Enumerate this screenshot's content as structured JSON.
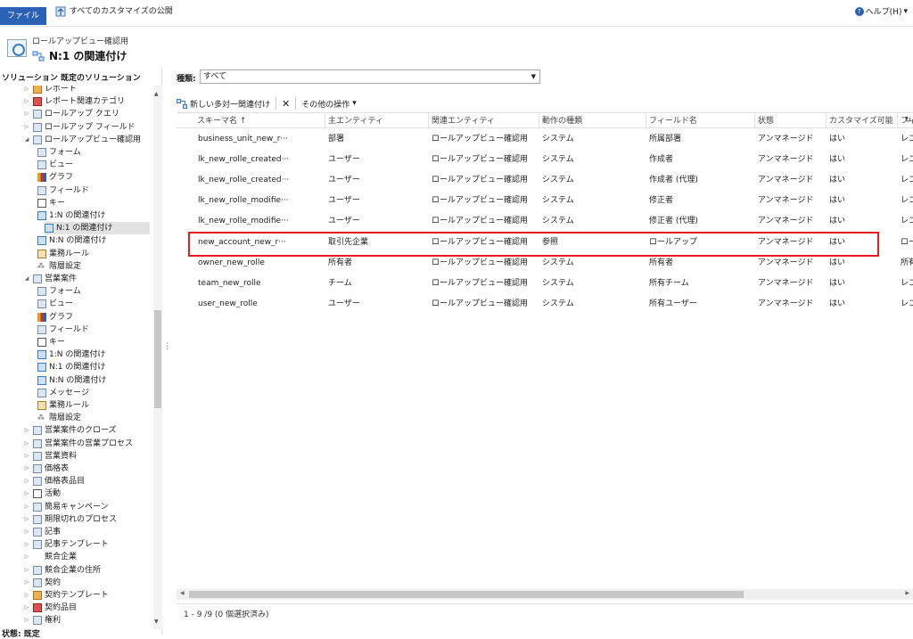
{
  "topbar": {
    "file_label": "ファイル",
    "publish_label": "すべてのカスタマイズの公開",
    "help_label": "ヘルプ(H)",
    "help_caret": "▾"
  },
  "header": {
    "entity_name": "ロールアップビュー確認用",
    "view_title": "N:1 の関連付け"
  },
  "sidebar": {
    "heading": "ソリューション 既定のソリューション",
    "bottom_label": "状態: 既定",
    "items": [
      {
        "label": "レポート",
        "icon": "report-icon",
        "arrow": "▷",
        "indent": 0
      },
      {
        "label": "レポート関連カテゴリ",
        "icon": "report-category-icon",
        "arrow": "▷",
        "indent": 0
      },
      {
        "label": "ロールアップ クエリ",
        "icon": "rollup-query-icon",
        "arrow": "▷",
        "indent": 0
      },
      {
        "label": "ロールアップ フィールド",
        "icon": "rollup-field-icon",
        "arrow": "▷",
        "indent": 0
      },
      {
        "label": "ロールアップビュー確認用",
        "icon": "entity-icon",
        "arrow": "◢",
        "indent": 0
      },
      {
        "label": "フォーム",
        "icon": "form-icon",
        "arrow": "",
        "indent": 1
      },
      {
        "label": "ビュー",
        "icon": "view-icon",
        "arrow": "",
        "indent": 1
      },
      {
        "label": "グラフ",
        "icon": "chart-icon",
        "arrow": "",
        "indent": 1
      },
      {
        "label": "フィールド",
        "icon": "field-icon",
        "arrow": "",
        "indent": 1
      },
      {
        "label": "キー",
        "icon": "key-icon",
        "arrow": "",
        "indent": 1
      },
      {
        "label": "1:N の関連付け",
        "icon": "relationship-icon",
        "arrow": "",
        "indent": 1
      },
      {
        "label": "N:1 の関連付け",
        "icon": "relationship-icon",
        "arrow": "",
        "indent": 1,
        "selected": true
      },
      {
        "label": "N:N の関連付け",
        "icon": "relationship-icon",
        "arrow": "",
        "indent": 1
      },
      {
        "label": "業務ルール",
        "icon": "business-rule-icon",
        "arrow": "",
        "indent": 1
      },
      {
        "label": "階層設定",
        "icon": "hierarchy-icon",
        "arrow": "",
        "indent": 1
      },
      {
        "label": "営業案件",
        "icon": "entity-icon",
        "arrow": "◢",
        "indent": 0
      },
      {
        "label": "フォーム",
        "icon": "form-icon",
        "arrow": "",
        "indent": 1
      },
      {
        "label": "ビュー",
        "icon": "view-icon",
        "arrow": "",
        "indent": 1
      },
      {
        "label": "グラフ",
        "icon": "chart-icon",
        "arrow": "",
        "indent": 1
      },
      {
        "label": "フィールド",
        "icon": "field-icon",
        "arrow": "",
        "indent": 1
      },
      {
        "label": "キー",
        "icon": "key-icon",
        "arrow": "",
        "indent": 1
      },
      {
        "label": "1:N の関連付け",
        "icon": "relationship-icon",
        "arrow": "",
        "indent": 1
      },
      {
        "label": "N:1 の関連付け",
        "icon": "relationship-icon",
        "arrow": "",
        "indent": 1
      },
      {
        "label": "N:N の関連付け",
        "icon": "relationship-icon",
        "arrow": "",
        "indent": 1
      },
      {
        "label": "メッセージ",
        "icon": "message-icon",
        "arrow": "",
        "indent": 1
      },
      {
        "label": "業務ルール",
        "icon": "business-rule-icon",
        "arrow": "",
        "indent": 1
      },
      {
        "label": "階層設定",
        "icon": "hierarchy-icon",
        "arrow": "",
        "indent": 1
      },
      {
        "label": "営業案件のクローズ",
        "icon": "opportunity-close-icon",
        "arrow": "▷",
        "indent": 0
      },
      {
        "label": "営業案件の営業プロセス",
        "icon": "sales-process-icon",
        "arrow": "▷",
        "indent": 0
      },
      {
        "label": "営業資料",
        "icon": "sales-literature-icon",
        "arrow": "▷",
        "indent": 0
      },
      {
        "label": "価格表",
        "icon": "price-list-icon",
        "arrow": "▷",
        "indent": 0
      },
      {
        "label": "価格表品目",
        "icon": "price-list-item-icon",
        "arrow": "▷",
        "indent": 0
      },
      {
        "label": "活動",
        "icon": "activity-icon",
        "arrow": "▷",
        "indent": 0
      },
      {
        "label": "簡易キャンペーン",
        "icon": "quick-campaign-icon",
        "arrow": "▷",
        "indent": 0
      },
      {
        "label": "期限切れのプロセス",
        "icon": "expired-process-icon",
        "arrow": "▷",
        "indent": 0
      },
      {
        "label": "記事",
        "icon": "article-icon",
        "arrow": "▷",
        "indent": 0
      },
      {
        "label": "記事テンプレート",
        "icon": "article-template-icon",
        "arrow": "▷",
        "indent": 0
      },
      {
        "label": "競合企業",
        "icon": "competitor-icon",
        "arrow": "▷",
        "indent": 0
      },
      {
        "label": "競合企業の住所",
        "icon": "competitor-address-icon",
        "arrow": "▷",
        "indent": 0
      },
      {
        "label": "契約",
        "icon": "contract-icon",
        "arrow": "▷",
        "indent": 0
      },
      {
        "label": "契約テンプレート",
        "icon": "contract-template-icon",
        "arrow": "▷",
        "indent": 0
      },
      {
        "label": "契約品目",
        "icon": "contract-line-icon",
        "arrow": "▷",
        "indent": 0
      },
      {
        "label": "権利",
        "icon": "entitlement-icon",
        "arrow": "▷",
        "indent": 0
      }
    ]
  },
  "filter": {
    "label": "種類:",
    "value": "すべて"
  },
  "toolbar": {
    "new_label": "新しい多対一関連付け",
    "delete_glyph": "✕",
    "more_label": "その他の操作",
    "more_caret": "▾"
  },
  "grid": {
    "columns": [
      "スキーマ名 ↑",
      "主エンティティ",
      "関連エンティティ",
      "動作の種類",
      "フィールド名",
      "状態",
      "カスタマイズ可能",
      "フィ-"
    ],
    "rows": [
      [
        "business_unit_new_r···",
        "部署",
        "ロールアップビュー確認用",
        "システム",
        "所属部署",
        "アンマネージド",
        "はい",
        "レコードを"
      ],
      [
        "lk_new_rolle_created···",
        "ユーザー",
        "ロールアップビュー確認用",
        "システム",
        "作成者",
        "アンマネージド",
        "はい",
        "レコードを"
      ],
      [
        "lk_new_rolle_created···",
        "ユーザー",
        "ロールアップビュー確認用",
        "システム",
        "作成者 (代理)",
        "アンマネージド",
        "はい",
        "レコードを"
      ],
      [
        "lk_new_rolle_modifie···",
        "ユーザー",
        "ロールアップビュー確認用",
        "システム",
        "修正者",
        "アンマネージド",
        "はい",
        "レコードを"
      ],
      [
        "lk_new_rolle_modifie···",
        "ユーザー",
        "ロールアップビュー確認用",
        "システム",
        "修正者 (代理)",
        "アンマネージド",
        "はい",
        "レコードを"
      ],
      [
        "new_account_new_r···",
        "取引先企業",
        "ロールアップビュー確認用",
        "参照",
        "ロールアップ",
        "アンマネージド",
        "はい",
        "ロールアッ"
      ],
      [
        "owner_new_rolle",
        "所有者",
        "ロールアップビュー確認用",
        "システム",
        "所有者",
        "アンマネージド",
        "はい",
        "所有者 I"
      ],
      [
        "team_new_rolle",
        "チーム",
        "ロールアップビュー確認用",
        "システム",
        "所有チーム",
        "アンマネージド",
        "はい",
        "レコードを"
      ],
      [
        "user_new_rolle",
        "ユーザー",
        "ロールアップビュー確認用",
        "システム",
        "所有ユーザー",
        "アンマネージド",
        "はい",
        "レコードを"
      ]
    ]
  },
  "status": {
    "text": "1 - 9 /9 (0 個選択済み)"
  },
  "colors": {
    "accent": "#2b62b5",
    "highlight_border": "#e81c1c"
  }
}
